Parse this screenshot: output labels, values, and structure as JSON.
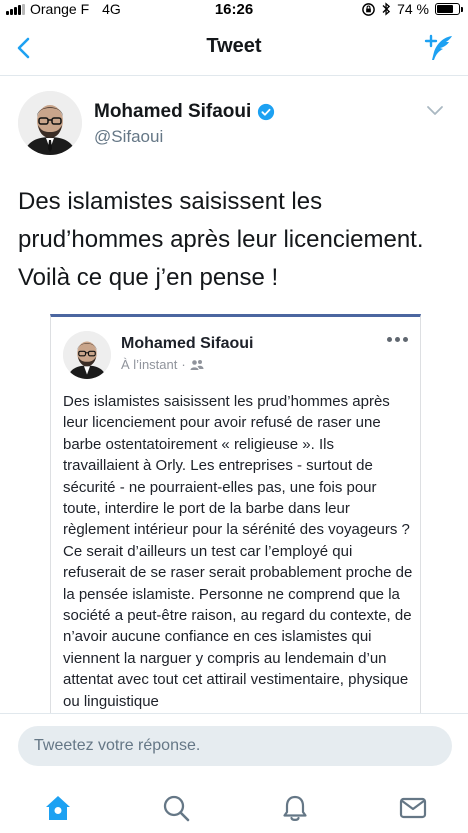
{
  "status_bar": {
    "carrier": "Orange F",
    "network": "4G",
    "time": "16:26",
    "battery": "74 %",
    "battery_level": 0.74
  },
  "header": {
    "title": "Tweet"
  },
  "tweet": {
    "author_name": "Mohamed Sifaoui",
    "author_handle": "@Sifaoui",
    "verified": true,
    "text": "Des islamistes saisissent les prud’hommes après leur licenciement. Voilà ce que j’en pense !"
  },
  "embed": {
    "author_name": "Mohamed Sifaoui",
    "time": "À l’instant",
    "separator": "·",
    "text": "Des islamistes saisissent les prud’hommes après leur licenciement pour avoir refusé de raser une barbe ostentatoirement « religieuse ». Ils travaillaient à Orly. Les entreprises - surtout de sécurité - ne pourraient-elles pas, une fois pour toute, interdire le port de la barbe dans leur règlement intérieur pour la sérénité des voyageurs ? Ce serait d’ailleurs un test car l’employé qui refuserait de se raser serait probablement proche de la pensée islamiste. Personne ne comprend que la société a peut-être raison, au regard du contexte, de n’avoir aucune confiance en ces islamistes qui viennent la narguer y compris au lendemain d’un attentat avec tout cet attirail vestimentaire, physique ou linguistique"
  },
  "reply": {
    "placeholder": "Tweetez votre réponse."
  },
  "colors": {
    "accent": "#1da1f2",
    "text": "#14171a",
    "muted": "#657786",
    "embed_border": "#4b66a0"
  },
  "icons": {
    "back": "back-chevron-icon",
    "compose": "compose-tweet-icon",
    "verified": "verified-badge-icon",
    "dropdown": "chevron-down-icon",
    "home": "home-icon",
    "search": "search-icon",
    "notifications": "bell-icon",
    "messages": "envelope-icon"
  }
}
